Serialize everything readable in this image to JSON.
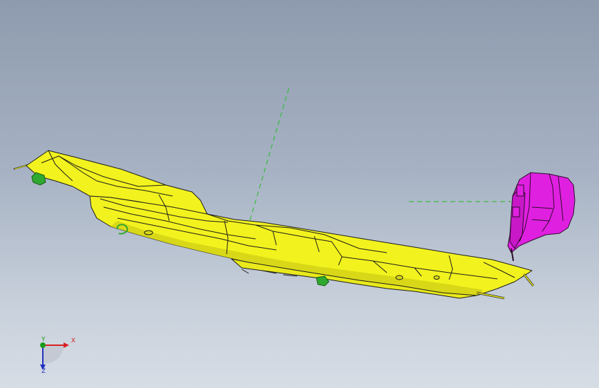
{
  "viewport": {
    "background_top": "#8e9bae",
    "background_bottom": "#d7dde5"
  },
  "model": {
    "main_part_color": "#f2f21e",
    "bracket_color": "#e020e0",
    "clip_color": "#2fa82f",
    "edge_color": "#1a1a1a",
    "datum_axis_color": "#1fc01f"
  },
  "triad": {
    "x_label": "X",
    "y_label": "Y",
    "z_label": "Z",
    "x_color": "#d62020",
    "y_color": "#1a9a1a",
    "z_color": "#2030c0"
  }
}
